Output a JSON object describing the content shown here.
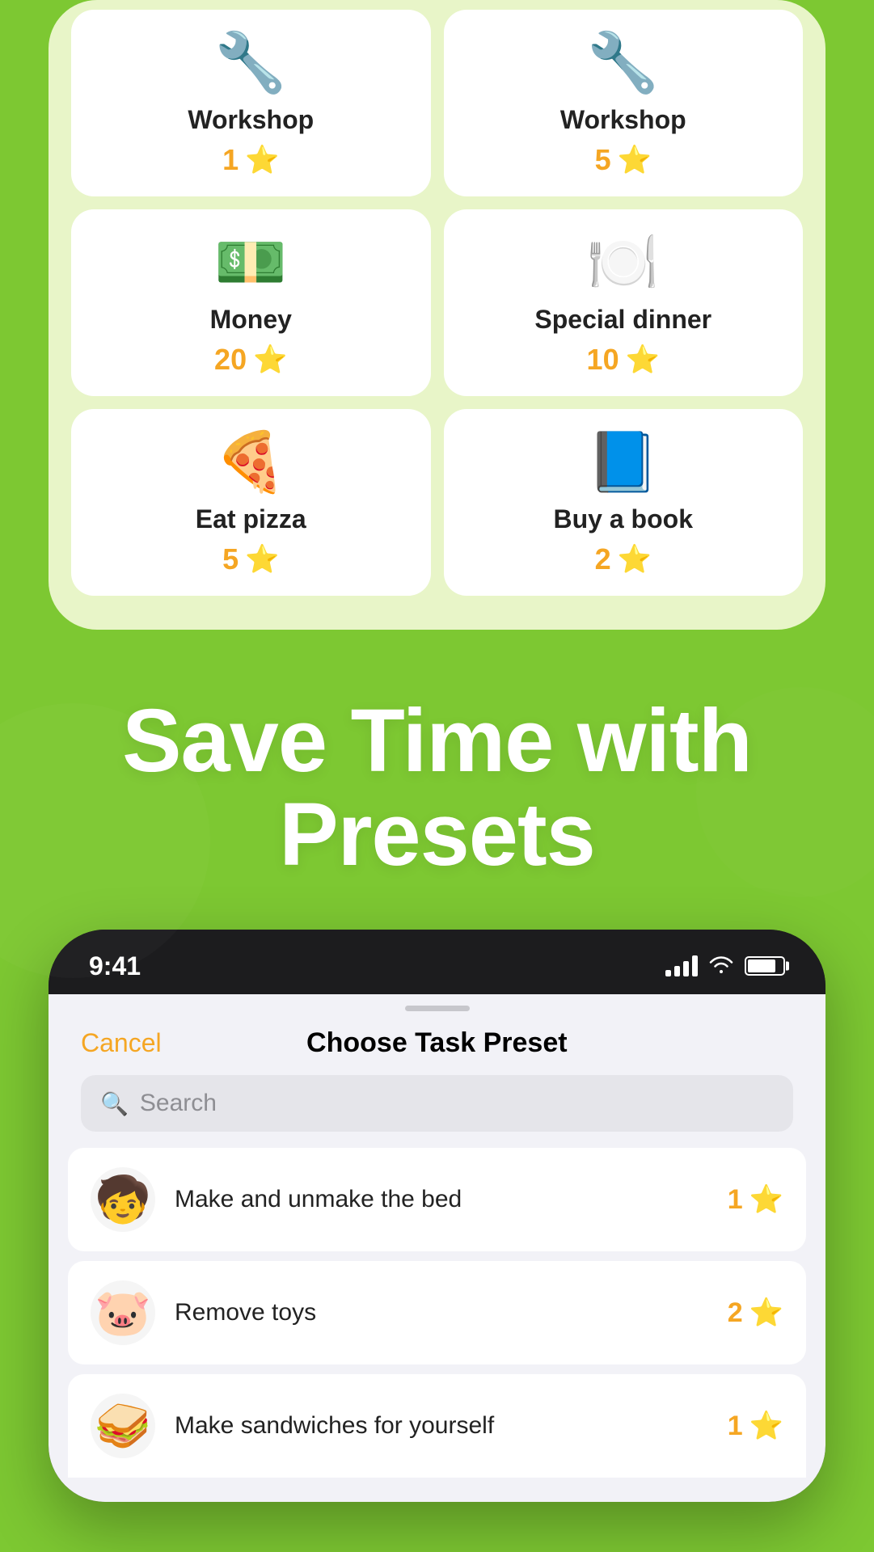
{
  "top_card": {
    "items": [
      {
        "id": "workshop1",
        "emoji": "🔧",
        "label": "Workshop",
        "count": "1"
      },
      {
        "id": "workshop5",
        "emoji": "🔧",
        "label": "Workshop",
        "count": "5"
      },
      {
        "id": "money20",
        "emoji": "💵",
        "label": "Money",
        "count": "20"
      },
      {
        "id": "special10",
        "emoji": "🍽️",
        "label": "Special dinner",
        "count": "10"
      },
      {
        "id": "eatpizza5",
        "emoji": "🍕",
        "label": "Eat pizza",
        "count": "5"
      },
      {
        "id": "buybook2",
        "emoji": "📘",
        "label": "Buy a book",
        "count": "2"
      }
    ]
  },
  "headline": {
    "line1": "Save Time with",
    "line2": "Presets"
  },
  "phone": {
    "status_bar": {
      "time": "9:41"
    },
    "modal": {
      "cancel_label": "Cancel",
      "title": "Choose Task Preset",
      "search_placeholder": "Search"
    },
    "tasks": [
      {
        "id": "bed",
        "emoji": "🧒",
        "label": "Make and unmake the bed",
        "count": "1"
      },
      {
        "id": "toys",
        "emoji": "🐷",
        "label": "Remove toys",
        "count": "2"
      },
      {
        "id": "sandwiches",
        "emoji": "🥪",
        "label": "Make sandwiches for yourself",
        "count": "1"
      }
    ]
  }
}
